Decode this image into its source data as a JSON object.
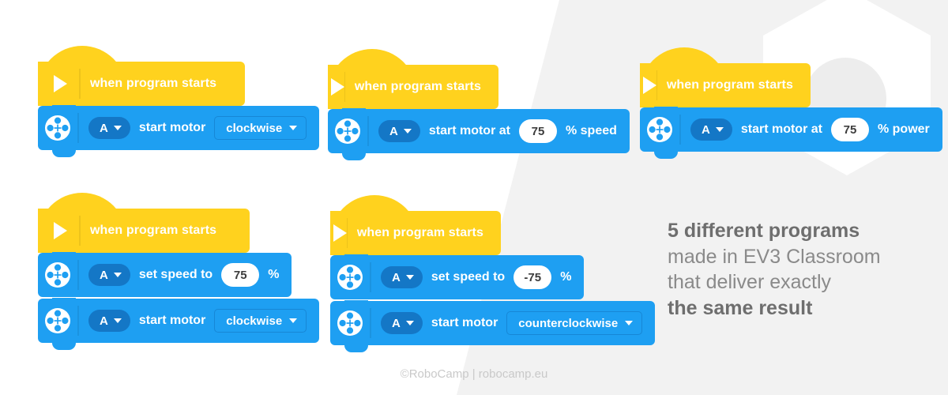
{
  "theme": {
    "bg_white": "#ffffff",
    "bg_gray": "#f2f2f2",
    "hat_yellow": "#ffd21e",
    "block_blue": "#1e9ff2",
    "dropdown_blue": "#1477c6",
    "text_white": "#ffffff",
    "caption_gray": "#8a8a8a",
    "caption_bold_gray": "#6e6e6e",
    "footer_gray": "#c9c9c9"
  },
  "icons": {
    "play": "play-triangle-icon",
    "motor": "ev3-motor-icon",
    "caret": "chevron-down-icon"
  },
  "hat_label": "when program starts",
  "programs": [
    {
      "id": "program-1",
      "blocks": [
        {
          "type": "start-motor-direction",
          "port": "A",
          "text": "start motor",
          "direction": "clockwise"
        }
      ]
    },
    {
      "id": "program-2",
      "blocks": [
        {
          "type": "start-motor-at-speed",
          "port": "A",
          "text_before": "start motor at",
          "value": "75",
          "text_after": "% speed"
        }
      ]
    },
    {
      "id": "program-3",
      "blocks": [
        {
          "type": "start-motor-at-power",
          "port": "A",
          "text_before": "start motor at",
          "value": "75",
          "text_after": "% power"
        }
      ]
    },
    {
      "id": "program-4",
      "blocks": [
        {
          "type": "set-speed",
          "port": "A",
          "text_before": "set speed to",
          "value": "75",
          "text_after": "%"
        },
        {
          "type": "start-motor-direction",
          "port": "A",
          "text": "start motor",
          "direction": "clockwise"
        }
      ]
    },
    {
      "id": "program-5",
      "blocks": [
        {
          "type": "set-speed",
          "port": "A",
          "text_before": "set speed to",
          "value": "-75",
          "text_after": "%"
        },
        {
          "type": "start-motor-direction",
          "port": "A",
          "text": "start motor",
          "direction": "counterclockwise"
        }
      ]
    }
  ],
  "caption": {
    "line1": "5 different programs",
    "line2": "made in EV3 Classroom",
    "line3": "that deliver exactly",
    "line4": "the same result"
  },
  "footer": {
    "text": "©RoboCamp | robocamp.eu"
  }
}
